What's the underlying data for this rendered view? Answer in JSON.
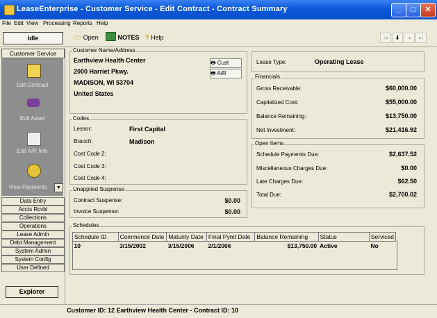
{
  "window": {
    "title": "LeaseEnterprise - Customer Service - Edit Contract - Contract Summary"
  },
  "menu": [
    "File",
    "Edit",
    "View",
    "Processing",
    "Reports",
    "Help"
  ],
  "toolbar": {
    "status": "Idle",
    "open": "Open",
    "notes": "NOTES",
    "help": "Help"
  },
  "sidebar": {
    "active_module": "Customer Service",
    "nav": [
      "Edit Contract",
      "Edit Asset",
      "Edit A/R Info",
      "View Payments"
    ],
    "modules": [
      "Data Entry",
      "Accts Rcvbl",
      "Collections",
      "Operations",
      "Lease Admin",
      "Debt Management",
      "System Admin",
      "System Config",
      "User Defined"
    ],
    "explorer": "Explorer"
  },
  "customer": {
    "group_label": "Customer Name/Address",
    "lines": [
      "Earthview Health Center",
      "2000 Harriet Pkwy.",
      "MADISON, WI  53704",
      "United States"
    ],
    "cust_button": "Cust",
    "ar_button": "A/R"
  },
  "codes": {
    "group_label": "Codes",
    "rows": [
      {
        "label": "Lessor:",
        "value": "First Capital"
      },
      {
        "label": "Branch:",
        "value": "Madison"
      },
      {
        "label": "Cost Code 2:",
        "value": ""
      },
      {
        "label": "Cost Code 3:",
        "value": ""
      },
      {
        "label": "Cost Code 4:",
        "value": ""
      }
    ]
  },
  "suspense": {
    "group_label": "Unapplied Suspense",
    "rows": [
      {
        "label": "Contract Suspense:",
        "value": "$0.00"
      },
      {
        "label": "Invoice Suspense:",
        "value": "$0.00"
      }
    ]
  },
  "lease": {
    "label": "Lease Type:",
    "value": "Operating Lease"
  },
  "financials": {
    "group_label": "Financials",
    "rows": [
      {
        "label": "Gross Receivable:",
        "value": "$60,000.00"
      },
      {
        "label": "Capitalized Cost:",
        "value": "$55,000.00"
      },
      {
        "label": "Balance Remaining:",
        "value": "$13,750.00"
      },
      {
        "label": "Net Investment:",
        "value": "$21,416.92"
      }
    ]
  },
  "open_items": {
    "group_label": "Open Items",
    "rows": [
      {
        "label": "Schedule Payments Due:",
        "value": "$2,637.52"
      },
      {
        "label": "Miscellaneous Charges Due:",
        "value": "$0.00"
      },
      {
        "label": "Late Charges Due:",
        "value": "$62.50"
      }
    ],
    "total_label": "Total Due:",
    "total_value": "$2,700.02"
  },
  "schedules": {
    "group_label": "Schedules",
    "columns": [
      "Schedule ID",
      "Commence Date",
      "Maturity Date",
      "Final Pymt Date",
      "Balance Remaining",
      "Status",
      "Serviced"
    ],
    "rows": [
      [
        "10",
        "3/15/2002",
        "3/15/2006",
        "2/1/2006",
        "$13,750.00",
        "Active",
        "No"
      ]
    ]
  },
  "statusbar": "Customer ID: 12  Earthview Health Center - Contract ID: 10"
}
